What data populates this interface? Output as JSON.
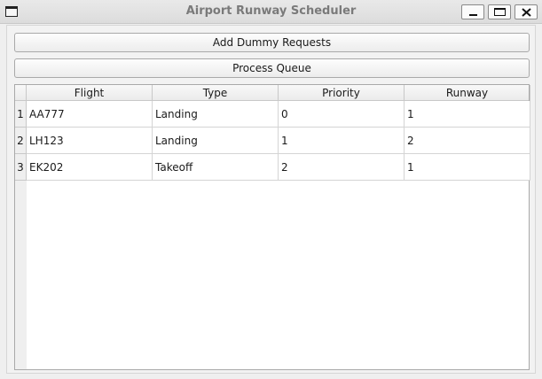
{
  "window": {
    "title": "Airport Runway Scheduler",
    "controls": [
      "minimize-icon",
      "maximize-icon",
      "close-icon"
    ]
  },
  "toolbar": {
    "add_label": "Add Dummy Requests",
    "process_label": "Process Queue"
  },
  "table": {
    "columns": [
      "Flight",
      "Type",
      "Priority",
      "Runway"
    ],
    "rows": [
      {
        "num": "1",
        "cells": [
          "AA777",
          "Landing",
          "0",
          "1"
        ]
      },
      {
        "num": "2",
        "cells": [
          "LH123",
          "Landing",
          "1",
          "2"
        ]
      },
      {
        "num": "3",
        "cells": [
          "EK202",
          "Takeoff",
          "2",
          "1"
        ]
      }
    ]
  },
  "colors": {
    "title_text": "#7a7a7a",
    "window_bg": "#efefef",
    "table_bg": "#ffffff",
    "grid": "#d4d4d4"
  }
}
